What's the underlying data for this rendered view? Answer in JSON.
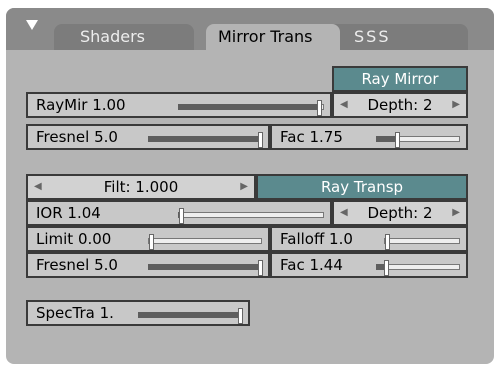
{
  "tabs": {
    "shaders": "Shaders",
    "mirror": "Mirror Trans",
    "sss": "SSS"
  },
  "mirror": {
    "toggle": "Ray Mirror",
    "raymir": {
      "label": "RayMir 1.00",
      "level": 0.98
    },
    "depth": "Depth: 2",
    "fresnel": {
      "label": "Fresnel 5.0",
      "level": 1.0
    },
    "fac": {
      "label": "Fac 1.75",
      "level": 0.25
    }
  },
  "transp": {
    "filt": "Filt: 1.000",
    "toggle": "Ray Transp",
    "ior": {
      "label": "IOR 1.04",
      "level": 0.02
    },
    "depth": "Depth: 2",
    "limit": {
      "label": "Limit 0.00",
      "level": 0.0
    },
    "falloff": {
      "label": "Falloff 1.0",
      "level": 0.0
    },
    "fresnel": {
      "label": "Fresnel 5.0",
      "level": 1.0
    },
    "fac": {
      "label": "Fac 1.44",
      "level": 0.12
    }
  },
  "spectra": {
    "label": "SpecTra 1.",
    "level": 1.0
  }
}
